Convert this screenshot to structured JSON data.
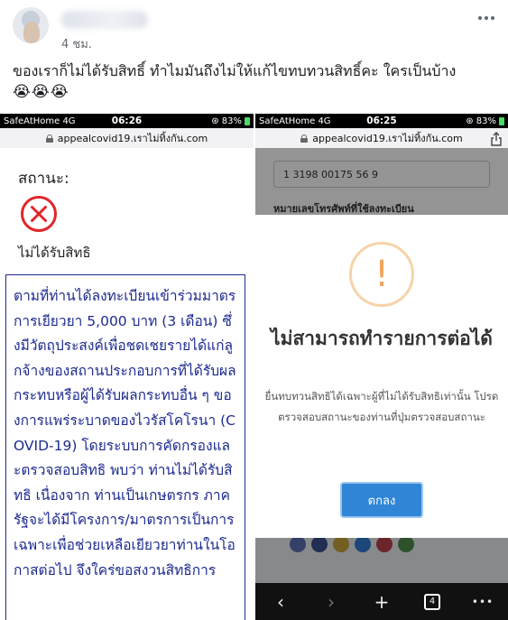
{
  "post": {
    "time": "4 ชม.",
    "text": "ของเราก็ไม่ได้รับสิทธิ์ ทำไมมันถึงไม่ให้แก้ไขทบทวนสิทธิ์คะ ใครเป็นบ้าง",
    "emojis": "😭😭😭"
  },
  "left_screen": {
    "status_bar": {
      "carrier": "SafeAtHome  4G",
      "time": "06:26",
      "battery": "⊛ 83%"
    },
    "url": "appealcovid19.เราไม่ทิ้งกัน.com",
    "status_label": "สถานะ:",
    "status_value": "ไม่ได้รับสิทธิ",
    "notice": "ตามที่ท่านได้ลงทะเบียนเข้าร่วมมาตรการเยียวยา 5,000 บาท (3 เดือน) ซึ่งมีวัตถุประสงค์เพื่อชดเชยรายได้แก่ลูกจ้างของสถานประกอบการที่ได้รับผลกระทบหรือผู้ได้รับผลกระทบอื่น ๆ ของการแพร่ระบาดของไวรัสโคโรนา (COVID-19) โดยระบบการคัดกรองและตรวจสอบสิทธิ พบว่า ท่านไม่ได้รับสิทธิ เนื่องจาก ท่านเป็นเกษตรกร ภาครัฐจะได้มีโครงการ/มาตรการเป็นการเฉพาะเพื่อช่วยเหลือเยียวยาท่านในโอกาสต่อไป จึงใคร่ขอสงวนสิทธิการ"
  },
  "right_screen": {
    "status_bar": {
      "carrier": "SafeAtHome  4G",
      "time": "06:25",
      "battery": "⊛ 83%"
    },
    "url": "appealcovid19.เราไม่ทิ้งกัน.com",
    "id_value": "1 3198 00175 56 9",
    "phone_label": "หมายเลขโทรศัพท์ที่ใช้ลงทะเบียน",
    "modal": {
      "icon": "!",
      "title": "ไม่สามารถทำรายการต่อได้",
      "message": "ยื่นทบทวนสิทธิได้เฉพาะผู้ที่ไม่ได้รับสิทธิเท่านั้น โปรดตรวจสอบสถานะของท่านที่ปุ่มตรวจสอบสถานะ",
      "ok_label": "ตกลง"
    },
    "toolbar": {
      "back": "‹",
      "forward": "›",
      "new_tab": "+",
      "tabs_count": "4",
      "more": "•••"
    }
  },
  "colors": {
    "notice_text": "#1d2b8f",
    "error_red": "#e0262b",
    "warning_orange": "#f2a65a",
    "button_blue": "#3085d6"
  }
}
